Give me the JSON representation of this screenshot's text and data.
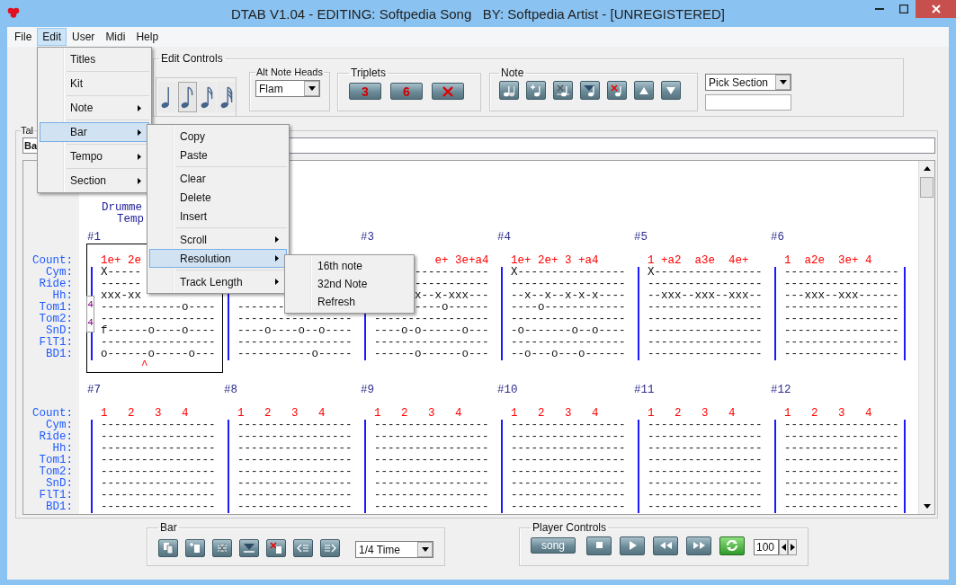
{
  "window": {
    "title": "DTAB V1.04 - EDITING: Softpedia Song   BY: Softpedia Artist - [UNREGISTERED]"
  },
  "menu_bar": [
    {
      "label": "File",
      "selected": false
    },
    {
      "label": "Edit",
      "selected": true
    },
    {
      "label": "User",
      "selected": false
    },
    {
      "label": "Midi",
      "selected": false
    },
    {
      "label": "Help",
      "selected": false
    }
  ],
  "edit_menu": [
    {
      "kind": "item",
      "label": "Titles",
      "submenu": false,
      "selected": false
    },
    {
      "kind": "separator"
    },
    {
      "kind": "item",
      "label": "Kit",
      "submenu": false,
      "selected": false
    },
    {
      "kind": "separator"
    },
    {
      "kind": "item",
      "label": "Note",
      "submenu": true,
      "selected": false
    },
    {
      "kind": "separator"
    },
    {
      "kind": "item",
      "label": "Bar",
      "submenu": true,
      "selected": true
    },
    {
      "kind": "separator"
    },
    {
      "kind": "item",
      "label": "Tempo",
      "submenu": true,
      "selected": false
    },
    {
      "kind": "separator"
    },
    {
      "kind": "item",
      "label": "Section",
      "submenu": true,
      "selected": false
    }
  ],
  "bar_menu": [
    {
      "kind": "item",
      "label": "Copy",
      "submenu": false,
      "selected": false
    },
    {
      "kind": "item",
      "label": "Paste",
      "submenu": false,
      "selected": false
    },
    {
      "kind": "separator"
    },
    {
      "kind": "item",
      "label": "Clear",
      "submenu": false,
      "selected": false
    },
    {
      "kind": "item",
      "label": "Delete",
      "submenu": false,
      "selected": false
    },
    {
      "kind": "item",
      "label": "Insert",
      "submenu": false,
      "selected": false
    },
    {
      "kind": "separator"
    },
    {
      "kind": "item",
      "label": "Scroll",
      "submenu": true,
      "selected": false
    },
    {
      "kind": "item",
      "label": "Resolution",
      "submenu": true,
      "selected": true
    },
    {
      "kind": "separator"
    },
    {
      "kind": "item",
      "label": "Track Length",
      "submenu": true,
      "selected": false
    }
  ],
  "resolution_menu": [
    {
      "kind": "item",
      "label": "16th note",
      "submenu": false,
      "selected": false
    },
    {
      "kind": "item",
      "label": "32nd Note",
      "submenu": false,
      "selected": false
    },
    {
      "kind": "item",
      "label": "Refresh",
      "submenu": false,
      "selected": false
    }
  ],
  "edit_controls": {
    "title": "Edit Controls",
    "note_lengths": [
      {
        "kind": "quarter",
        "selected": false
      },
      {
        "kind": "eighth",
        "selected": true
      },
      {
        "kind": "sixteenth",
        "selected": false
      },
      {
        "kind": "thirtysecond",
        "selected": false
      }
    ],
    "alt_note_heads": {
      "title": "Alt Note Heads",
      "value": "Flam"
    },
    "triplets": {
      "title": "Triplets",
      "buttons": [
        {
          "kind": "label",
          "label": "3"
        },
        {
          "kind": "label",
          "label": "6"
        },
        {
          "kind": "clear"
        }
      ]
    },
    "note": {
      "title": "Note",
      "buttons": [
        {
          "kind": "note"
        },
        {
          "kind": "add"
        },
        {
          "kind": "clear"
        },
        {
          "kind": "fill"
        },
        {
          "kind": "delete"
        },
        {
          "kind": "up"
        },
        {
          "kind": "down"
        }
      ]
    },
    "pick_section": {
      "value": "Pick Section"
    }
  },
  "tab": {
    "title": "Tal",
    "field": "Ba",
    "header": [
      "Drumme",
      "Temp"
    ],
    "systems": [
      {
        "labels": [
          "Count:",
          "Cym:",
          "Ride:",
          "Hh:",
          "Tom1:",
          "Tom2:",
          "SnD:",
          "FlT1:",
          "BD1:"
        ],
        "bars": [
          {
            "number": "#1",
            "selected": true,
            "count": "1e+ 2e",
            "time_signature": [
              "4",
              "4"
            ],
            "caret": "^",
            "lines": [
              "X-----",
              "------",
              "xxx-xx",
              "------------o----",
              "-----------------",
              "f------o----o----",
              "-----------------",
              "o------o-----o---"
            ]
          },
          {
            "selected": false,
            "lines": [
              "-------",
              "-----------------",
              "----o----o--o----",
              "-----------------",
              "-----------o-----"
            ]
          },
          {
            "number": "#3",
            "selected": false,
            "cut_left": true,
            "count": "e+ 3e+a4",
            "lines": [
              "-----------",
              "-----------",
              "x--x-xxx---",
              "----o------",
              "-----------------",
              "----o-o------o---",
              "-----------------",
              "------o------o---"
            ]
          },
          {
            "number": "#4",
            "selected": false,
            "count": "1e+ 2e+ 3 +a4",
            "lines": [
              "X----------------",
              "-----------------",
              "--x--x--x-x-x----",
              "----o------------",
              "-----------------",
              "-o-------o--o----",
              "-----------------",
              "--o---o---o------"
            ]
          },
          {
            "number": "#5",
            "selected": false,
            "count": "1 +a2  a3e  4e+",
            "lines": [
              "X----------------",
              "-----------------",
              "--xxx--xxx--xxx--",
              "-----------------",
              "-----------------",
              "-----------------",
              "-----------------",
              "-----------------"
            ]
          },
          {
            "number": "#6",
            "selected": false,
            "count": "1  a2e  3e+ 4",
            "lines": [
              "-----------------",
              "-----------------",
              "---xxx--xxx------",
              "-----------------",
              "-----------------",
              "-----------------",
              "-----------------",
              "-----------------"
            ]
          }
        ]
      },
      {
        "labels": [
          "Count:",
          "Cym:",
          "Ride:",
          "Hh:",
          "Tom1:",
          "Tom2:",
          "SnD:",
          "FlT1:",
          "BD1:"
        ],
        "bars": [
          {
            "number": "#7",
            "selected": false,
            "count": "1   2   3   4",
            "lines": [
              "-----------------",
              "-----------------",
              "-----------------",
              "-----------------",
              "-----------------",
              "-----------------",
              "-----------------",
              "-----------------"
            ]
          },
          {
            "number": "#8",
            "selected": false,
            "count": "1   2   3   4",
            "lines": [
              "-----------------",
              "-----------------",
              "-----------------",
              "-----------------",
              "-----------------",
              "-----------------",
              "-----------------",
              "-----------------"
            ]
          },
          {
            "number": "#9",
            "selected": false,
            "count": "1   2   3   4",
            "lines": [
              "-----------------",
              "-----------------",
              "-----------------",
              "-----------------",
              "-----------------",
              "-----------------",
              "-----------------",
              "-----------------"
            ]
          },
          {
            "number": "#10",
            "selected": false,
            "count": "1   2   3   4",
            "lines": [
              "-----------------",
              "-----------------",
              "-----------------",
              "-----------------",
              "-----------------",
              "-----------------",
              "-----------------",
              "-----------------"
            ]
          },
          {
            "number": "#11",
            "selected": false,
            "count": "1   2   3   4",
            "lines": [
              "-----------------",
              "-----------------",
              "-----------------",
              "-----------------",
              "-----------------",
              "-----------------",
              "-----------------",
              "-----------------"
            ]
          },
          {
            "number": "#12",
            "selected": false,
            "count": "1   2   3   4",
            "lines": [
              "-----------------",
              "-----------------",
              "-----------------",
              "-----------------",
              "-----------------",
              "-----------------",
              "-----------------",
              "-----------------"
            ]
          }
        ]
      }
    ]
  },
  "bar_controls": {
    "title": "Bar",
    "buttons": [
      {
        "kind": "copy"
      },
      {
        "kind": "insert"
      },
      {
        "kind": "clear"
      },
      {
        "kind": "fill"
      },
      {
        "kind": "delete"
      },
      {
        "kind": "left"
      },
      {
        "kind": "right"
      }
    ],
    "time": "1/4 Time"
  },
  "player_controls": {
    "title": "Player Controls",
    "song": "song",
    "buttons": [
      {
        "kind": "stop"
      },
      {
        "kind": "play"
      },
      {
        "kind": "rewind"
      },
      {
        "kind": "forward"
      },
      {
        "kind": "loop"
      }
    ],
    "tempo": "100"
  }
}
